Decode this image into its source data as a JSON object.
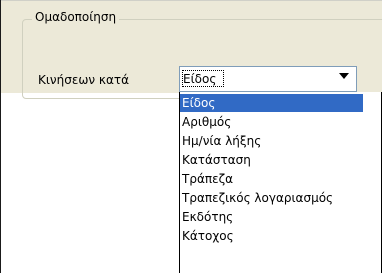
{
  "group": {
    "title": "Ομαδοποίηση"
  },
  "grouping": {
    "label": "Κινήσεων κατά",
    "selected": "Είδος",
    "options": [
      "Είδος",
      "Αριθμός",
      "Ημ/νία λήξης",
      "Κατάσταση",
      "Τράπεζα",
      "Τραπεζικός λογαριασμός",
      "Εκδότης",
      "Κάτοχος"
    ]
  },
  "colors": {
    "panel": "#ece9d8",
    "selection": "#316ac5",
    "combo_border": "#7f9db9"
  },
  "icons": {
    "dropdown_arrow": "chevron-down-icon"
  }
}
